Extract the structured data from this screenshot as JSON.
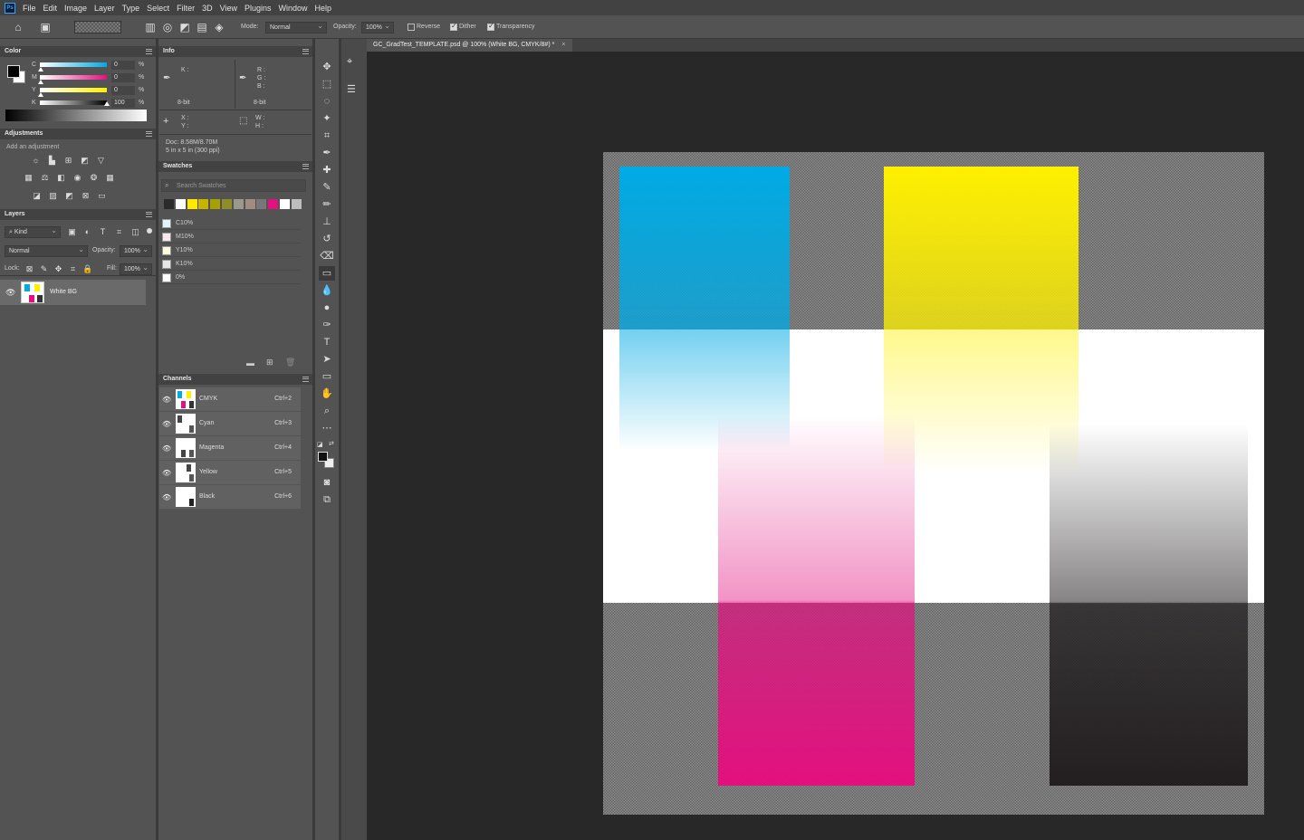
{
  "menubar": {
    "app_icon": "Ps",
    "items": [
      "File",
      "Edit",
      "Image",
      "Layer",
      "Type",
      "Select",
      "Filter",
      "3D",
      "View",
      "Plugins",
      "Window",
      "Help"
    ]
  },
  "options": {
    "mode_label": "Mode:",
    "mode_value": "Normal",
    "opacity_label": "Opacity:",
    "opacity_value": "100%",
    "reverse_label": "Reverse",
    "dither_label": "Dither",
    "transparency_label": "Transparency",
    "reverse_checked": false,
    "dither_checked": true,
    "transparency_checked": true
  },
  "color_panel": {
    "title": "Color",
    "channels": [
      {
        "label": "C",
        "value": "0",
        "unit": "%"
      },
      {
        "label": "M",
        "value": "0",
        "unit": "%"
      },
      {
        "label": "Y",
        "value": "0",
        "unit": "%"
      },
      {
        "label": "K",
        "value": "100",
        "unit": "%"
      }
    ]
  },
  "adjustments_panel": {
    "title": "Adjustments",
    "hint": "Add an adjustment"
  },
  "layers_panel": {
    "title": "Layers",
    "kind_label": "Kind",
    "blend_mode": "Normal",
    "opacity_label": "Opacity:",
    "opacity_value": "100%",
    "lock_label": "Lock:",
    "fill_label": "Fill:",
    "fill_value": "100%",
    "layers": [
      {
        "name": "White BG",
        "visible": true
      }
    ]
  },
  "info_panel": {
    "title": "Info",
    "k_label": "K :",
    "r_label": "R :",
    "g_label": "G :",
    "b_label": "B :",
    "bit_left": "8-bit",
    "bit_right": "8-bit",
    "x_label": "X :",
    "y_label": "Y :",
    "w_label": "W :",
    "h_label": "H :",
    "doc_line": "Doc: 8.58M/8.70M",
    "size_line": "5 in x 5 in (300 ppi)"
  },
  "swatches_panel": {
    "title": "Swatches",
    "search_placeholder": "Search Swatches",
    "colors": [
      "#2a2a2a",
      "#ffffff",
      "#ffe800",
      "#c7b400",
      "#a8a000",
      "#8f8d28",
      "#9a9a8a",
      "#a08c80",
      "#777777",
      "#e3107f",
      "#ffffff",
      "#bdbdbd"
    ],
    "items": [
      {
        "name": "C10%",
        "color": "#e3f4fc"
      },
      {
        "name": "M10%",
        "color": "#fbe7f0"
      },
      {
        "name": "Y10%",
        "color": "#fffbe0"
      },
      {
        "name": "K10%",
        "color": "#e6e6e6"
      },
      {
        "name": "0%",
        "color": "#ffffff"
      }
    ]
  },
  "channels_panel": {
    "title": "Channels",
    "channels": [
      {
        "name": "CMYK",
        "shortcut": "Ctrl+2"
      },
      {
        "name": "Cyan",
        "shortcut": "Ctrl+3"
      },
      {
        "name": "Magenta",
        "shortcut": "Ctrl+4"
      },
      {
        "name": "Yellow",
        "shortcut": "Ctrl+5"
      },
      {
        "name": "Black",
        "shortcut": "Ctrl+6"
      }
    ]
  },
  "document": {
    "tab_title": "GC_GradTest_TEMPLATE.psd @ 100% (White BG, CMYK/8#) *",
    "colors": {
      "cyan": "#00aae4",
      "magenta": "#e3107f",
      "yellow": "#fff000",
      "black": "#231f20"
    }
  },
  "tools": [
    "move-icon",
    "marquee-icon",
    "lasso-icon",
    "magic-wand-icon",
    "crop-icon",
    "eyedropper-icon",
    "healing-brush-icon",
    "brush-icon",
    "stamp-icon",
    "history-brush-icon",
    "eraser-icon",
    "gradient-icon",
    "blur-icon",
    "dodge-icon",
    "pen-icon",
    "type-icon",
    "path-select-icon",
    "rectangle-icon",
    "hand-icon",
    "zoom-icon",
    "more-tools-icon"
  ]
}
